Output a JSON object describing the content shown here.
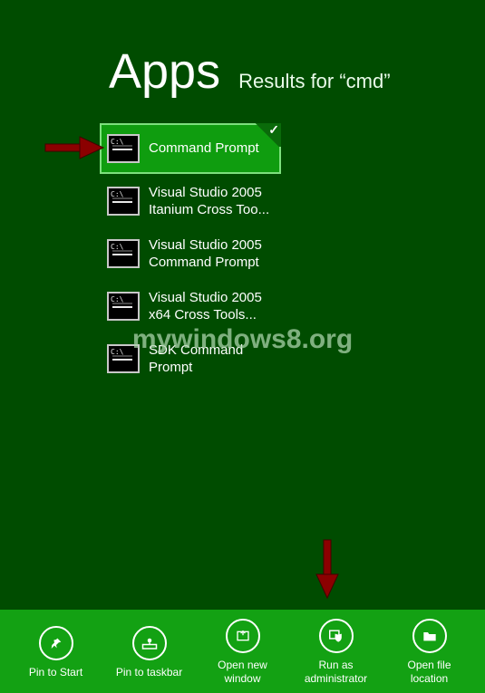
{
  "header": {
    "title": "Apps",
    "subtitle": "Results for “cmd”"
  },
  "results": [
    {
      "label": "Command Prompt",
      "selected": true
    },
    {
      "label": "Visual Studio 2005 Itanium Cross Too..."
    },
    {
      "label": "Visual Studio 2005 Command Prompt"
    },
    {
      "label": "Visual Studio 2005 x64 Cross Tools..."
    },
    {
      "label": "SDK Command Prompt"
    }
  ],
  "appbar": {
    "pin_start": "Pin to Start",
    "pin_taskbar": "Pin to taskbar",
    "open_new": "Open new window",
    "run_admin": "Run as administrator",
    "open_loc": "Open file location"
  },
  "watermark": "mywindows8.org"
}
